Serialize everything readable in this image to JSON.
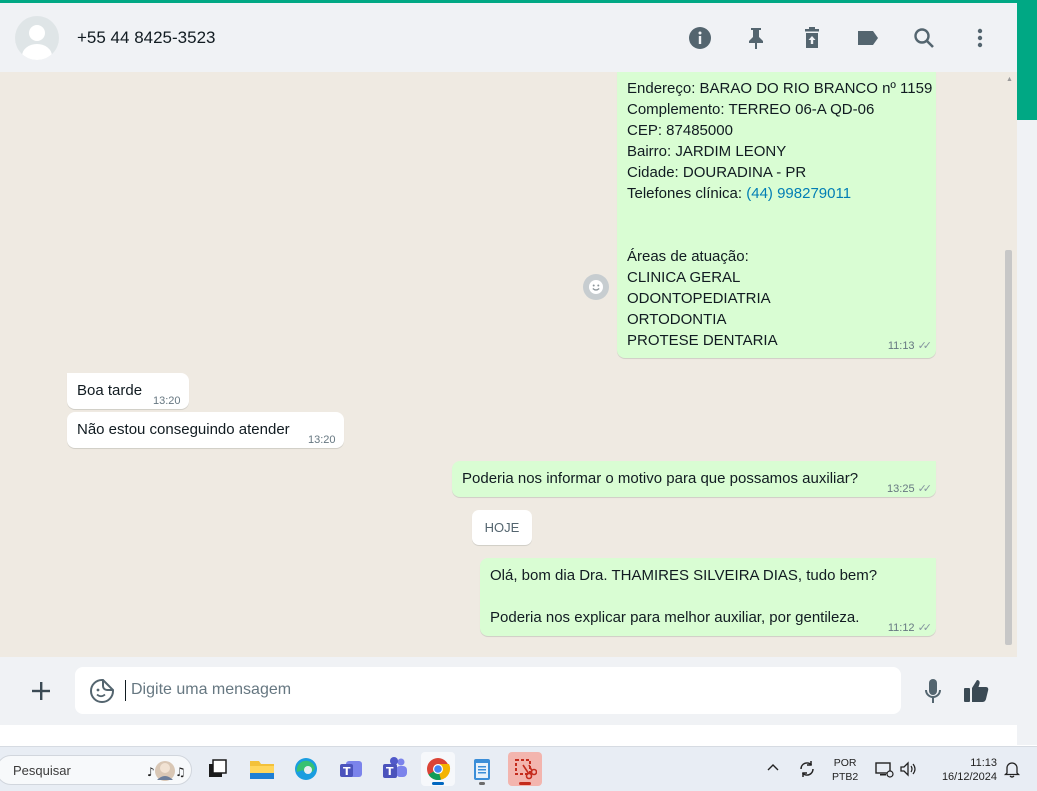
{
  "header": {
    "contact_name": "+55 44 8425-3523",
    "icons": [
      "info-icon",
      "pin-icon",
      "delete-icon",
      "label-icon",
      "search-icon",
      "menu-icon"
    ]
  },
  "messages": {
    "m1": {
      "lines": [
        "Endereço: BARAO DO RIO BRANCO nº 1159",
        "Complemento: TERREO 06-A QD-06",
        "CEP: 87485000",
        "Bairro: JARDIM LEONY",
        "Cidade: DOURADINA - PR"
      ],
      "phone_label": "Telefones clínica: ",
      "phone_link": "(44) 998279011",
      "areas_title": "Áreas de atuação:",
      "areas": [
        "CLINICA GERAL",
        "ODONTOPEDIATRIA",
        "ORTODONTIA",
        "PROTESE DENTARIA"
      ],
      "time": "11:13"
    },
    "m2": {
      "text": "Boa tarde",
      "time": "13:20"
    },
    "m3": {
      "text": "Não estou conseguindo atender",
      "time": "13:20"
    },
    "m4": {
      "text": "Poderia nos informar o motivo para que possamos auxiliar?",
      "time": "13:25"
    },
    "date_chip": "HOJE",
    "m5": {
      "line1": "Olá, bom dia Dra. THAMIRES SILVEIRA DIAS, tudo bem?",
      "line2": "Poderia nos explicar para melhor auxiliar, por gentileza.",
      "time": "11:12"
    }
  },
  "composer": {
    "placeholder": "Digite uma mensagem"
  },
  "taskbar": {
    "search_label": "Pesquisar",
    "lang_line1": "POR",
    "lang_line2": "PTB2",
    "time": "11:13",
    "date": "16/12/2024"
  },
  "colors": {
    "accent": "#00a884",
    "outgoing_bubble": "#d9fdd3",
    "incoming_bubble": "#ffffff",
    "chat_background": "#efeae2",
    "link": "#027eb5"
  }
}
